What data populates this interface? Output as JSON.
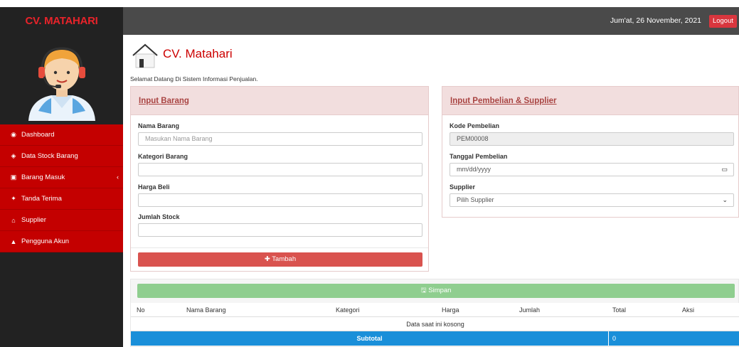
{
  "header": {
    "brand": "CV. MATAHARI",
    "date": "Jum'at, 26 November, 2021",
    "logout": "Logout"
  },
  "sidebar": {
    "items": [
      {
        "label": "Dashboard",
        "icon": "dashboard-icon",
        "glyph": "◉"
      },
      {
        "label": "Data Stock Barang",
        "icon": "box-icon",
        "glyph": "◈"
      },
      {
        "label": "Barang Masuk",
        "icon": "money-icon",
        "glyph": "▣",
        "caret": "‹"
      },
      {
        "label": "Tanda Terima",
        "icon": "users-icon",
        "glyph": "✦"
      },
      {
        "label": "Supplier",
        "icon": "home-icon",
        "glyph": "⌂"
      },
      {
        "label": "Pengguna Akun",
        "icon": "user-icon",
        "glyph": "▲"
      }
    ]
  },
  "main": {
    "title": "CV. Matahari",
    "welcome": "Selamat Datang Di Sistem Informasi Penjualan."
  },
  "barang": {
    "heading": "Input Barang",
    "nama_label": "Nama Barang",
    "nama_placeholder": "Masukan Nama Barang",
    "kategori_label": "Kategori Barang",
    "kategori_value": "",
    "harga_label": "Harga Beli",
    "harga_value": "",
    "stock_label": "Jumlah Stock",
    "stock_value": "",
    "tambah": "✚ Tambah"
  },
  "pembelian": {
    "heading": "Input Pembelian & Supplier",
    "kode_label": "Kode Pembelian",
    "kode_value": "PEM00008",
    "tanggal_label": "Tanggal Pembelian",
    "tanggal_placeholder": "mm/dd/yyyy",
    "supplier_label": "Supplier",
    "supplier_selected": "Pilih Supplier"
  },
  "cart": {
    "simpan": "🖫 Simpan",
    "columns": [
      "No",
      "Nama Barang",
      "Kategori",
      "Harga",
      "Jumlah",
      "Total",
      "Aksi"
    ],
    "empty": "Data saat ini kosong",
    "subtotal_label": "Subtotal",
    "subtotal_value": "0"
  },
  "colors": {
    "brand_red": "#e8232a",
    "sidebar_menu": "#c40000",
    "panel_head": "#f2dede",
    "btn_tambah": "#d9534f",
    "btn_simpan": "#8fce8f",
    "subtotal_bar": "#1a8fd9"
  }
}
